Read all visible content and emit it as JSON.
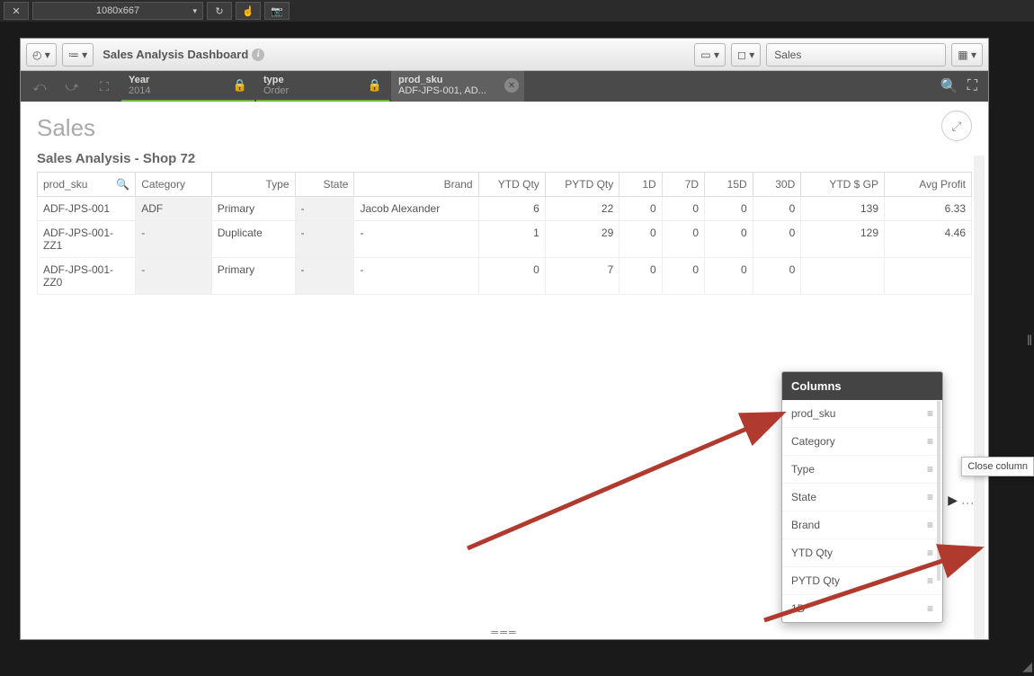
{
  "topbar": {
    "resolution": "1080x667"
  },
  "window": {
    "title": "Sales Analysis Dashboard",
    "breadcrumb": "Sales"
  },
  "filters": {
    "year": {
      "label": "Year",
      "value": "2014"
    },
    "type": {
      "label": "type",
      "value": "Order"
    },
    "prod_sku": {
      "label": "prod_sku",
      "value": "ADF-JPS-001, AD..."
    }
  },
  "page": {
    "heading": "Sales",
    "subheading": "Sales Analysis - Shop 72"
  },
  "table": {
    "headers": {
      "prod_sku": "prod_sku",
      "category": "Category",
      "type": "Type",
      "state": "State",
      "brand": "Brand",
      "ytd_qty": "YTD Qty",
      "pytd_qty": "PYTD Qty",
      "d1": "1D",
      "d7": "7D",
      "d15": "15D",
      "d30": "30D",
      "ytd_gp": "YTD $ GP",
      "avg_profit": "Avg Profit"
    },
    "rows": [
      {
        "sku": "ADF-JPS-001",
        "cat": "ADF",
        "type": "Primary",
        "state": "-",
        "brand": "Jacob Alexander",
        "ytd": "6",
        "pytd": "22",
        "d1": "0",
        "d7": "0",
        "d15": "0",
        "d30": "0",
        "gp": "139",
        "ap": "6.33"
      },
      {
        "sku": "ADF-JPS-001-ZZ1",
        "cat": "-",
        "type": "Duplicate",
        "state": "-",
        "brand": "-",
        "ytd": "1",
        "pytd": "29",
        "d1": "0",
        "d7": "0",
        "d15": "0",
        "d30": "0",
        "gp": "129",
        "ap": "4.46"
      },
      {
        "sku": "ADF-JPS-001-ZZ0",
        "cat": "-",
        "type": "Primary",
        "state": "-",
        "brand": "-",
        "ytd": "0",
        "pytd": "7",
        "d1": "0",
        "d7": "0",
        "d15": "0",
        "d30": "0",
        "gp": "",
        "ap": ""
      }
    ]
  },
  "columns_panel": {
    "title": "Columns",
    "items": [
      "prod_sku",
      "Category",
      "Type",
      "State",
      "Brand",
      "YTD Qty",
      "PYTD Qty",
      "1D"
    ]
  },
  "tooltip": "Close column"
}
